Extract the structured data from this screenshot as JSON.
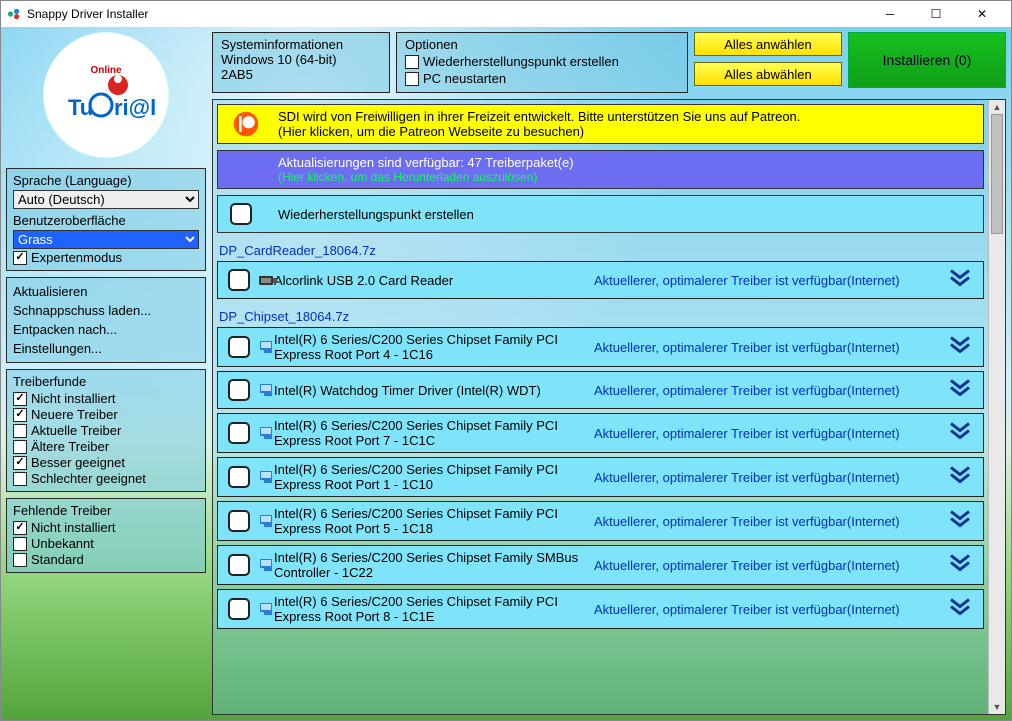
{
  "window": {
    "title": "Snappy Driver Installer"
  },
  "sysinfo": {
    "h": "Systeminformationen",
    "l1": "Windows 10 (64-bit)",
    "l2": "2AB5"
  },
  "options": {
    "h": "Optionen",
    "o1": "Wiederherstellungspunkt erstellen",
    "o2": "PC neustarten"
  },
  "buttons": {
    "select_all": "Alles anwählen",
    "deselect_all": "Alles abwählen",
    "install": "Installieren (0)"
  },
  "banners": {
    "p1": "SDI wird von Freiwilligen in ihrer Freizeit entwickelt. Bitte unterstützen Sie uns auf Patreon.",
    "p2": "(Hier klicken, um die Patreon Webseite zu besuchen)",
    "u1": "Aktualisierungen sind verfügbar: 47 Treiberpaket(e)",
    "u2": "(Hier klicken, um das Herunterladen auszulösen)",
    "r1": "Wiederherstellungspunkt erstellen"
  },
  "left": {
    "lang_h": "Sprache (Language)",
    "lang_v": "Auto (Deutsch)",
    "ui_h": "Benutzeroberfläche",
    "ui_v": "Grass",
    "expert": "Expertenmodus",
    "actions": [
      "Aktualisieren",
      "Schnappschuss laden...",
      "Entpacken nach...",
      "Einstellungen..."
    ],
    "found_h": "Treiberfunde",
    "found": [
      {
        "label": "Nicht installiert",
        "on": true
      },
      {
        "label": "Neuere Treiber",
        "on": true
      },
      {
        "label": "Aktuelle Treiber",
        "on": false
      },
      {
        "label": "Ältere Treiber",
        "on": false
      },
      {
        "label": "Besser geeignet",
        "on": true
      },
      {
        "label": "Schlechter geeignet",
        "on": false
      }
    ],
    "missing_h": "Fehlende Treiber",
    "missing": [
      {
        "label": "Nicht installiert",
        "on": true
      },
      {
        "label": "Unbekannt",
        "on": false
      },
      {
        "label": "Standard",
        "on": false
      }
    ]
  },
  "groups": [
    {
      "title": "DP_CardReader_18064.7z",
      "items": [
        {
          "name": "Alcorlink USB 2.0 Card Reader",
          "status": "Aktuellerer, optimalerer Treiber ist verfügbar(Internet)",
          "kind": "card"
        }
      ]
    },
    {
      "title": "DP_Chipset_18064.7z",
      "items": [
        {
          "name": "Intel(R) 6 Series/C200 Series Chipset Family PCI Express Root Port 4 - 1C16",
          "status": "Aktuellerer, optimalerer Treiber ist verfügbar(Internet)",
          "kind": "chip"
        },
        {
          "name": "Intel(R) Watchdog Timer Driver (Intel(R) WDT)",
          "status": "Aktuellerer, optimalerer Treiber ist verfügbar(Internet)",
          "kind": "chip"
        },
        {
          "name": "Intel(R) 6 Series/C200 Series Chipset Family PCI Express Root Port 7 - 1C1C",
          "status": "Aktuellerer, optimalerer Treiber ist verfügbar(Internet)",
          "kind": "chip"
        },
        {
          "name": "Intel(R) 6 Series/C200 Series Chipset Family PCI Express Root Port 1 - 1C10",
          "status": "Aktuellerer, optimalerer Treiber ist verfügbar(Internet)",
          "kind": "chip"
        },
        {
          "name": "Intel(R) 6 Series/C200 Series Chipset Family PCI Express Root Port 5 - 1C18",
          "status": "Aktuellerer, optimalerer Treiber ist verfügbar(Internet)",
          "kind": "chip"
        },
        {
          "name": "Intel(R) 6 Series/C200 Series Chipset Family SMBus Controller - 1C22",
          "status": "Aktuellerer, optimalerer Treiber ist verfügbar(Internet)",
          "kind": "chip"
        },
        {
          "name": "Intel(R) 6 Series/C200 Series Chipset Family PCI Express Root Port 8 - 1C1E",
          "status": "Aktuellerer, optimalerer Treiber ist verfügbar(Internet)",
          "kind": "chip"
        }
      ]
    }
  ]
}
